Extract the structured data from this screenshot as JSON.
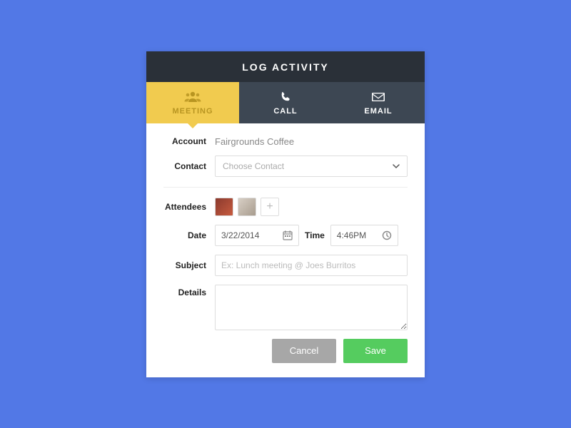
{
  "header": {
    "title": "LOG ACTIVITY"
  },
  "tabs": [
    {
      "label": "MEETING",
      "icon": "people-icon",
      "active": true
    },
    {
      "label": "CALL",
      "icon": "phone-icon",
      "active": false
    },
    {
      "label": "EMAIL",
      "icon": "envelope-icon",
      "active": false
    }
  ],
  "form": {
    "account": {
      "label": "Account",
      "value": "Fairgrounds Coffee"
    },
    "contact": {
      "label": "Contact",
      "placeholder": "Choose Contact"
    },
    "attendees": {
      "label": "Attendees"
    },
    "date": {
      "label": "Date",
      "value": "3/22/2014"
    },
    "time": {
      "label": "Time",
      "value": "4:46PM"
    },
    "subject": {
      "label": "Subject",
      "placeholder": "Ex: Lunch meeting @ Joes Burritos"
    },
    "details": {
      "label": "Details"
    }
  },
  "actions": {
    "cancel": "Cancel",
    "save": "Save"
  }
}
